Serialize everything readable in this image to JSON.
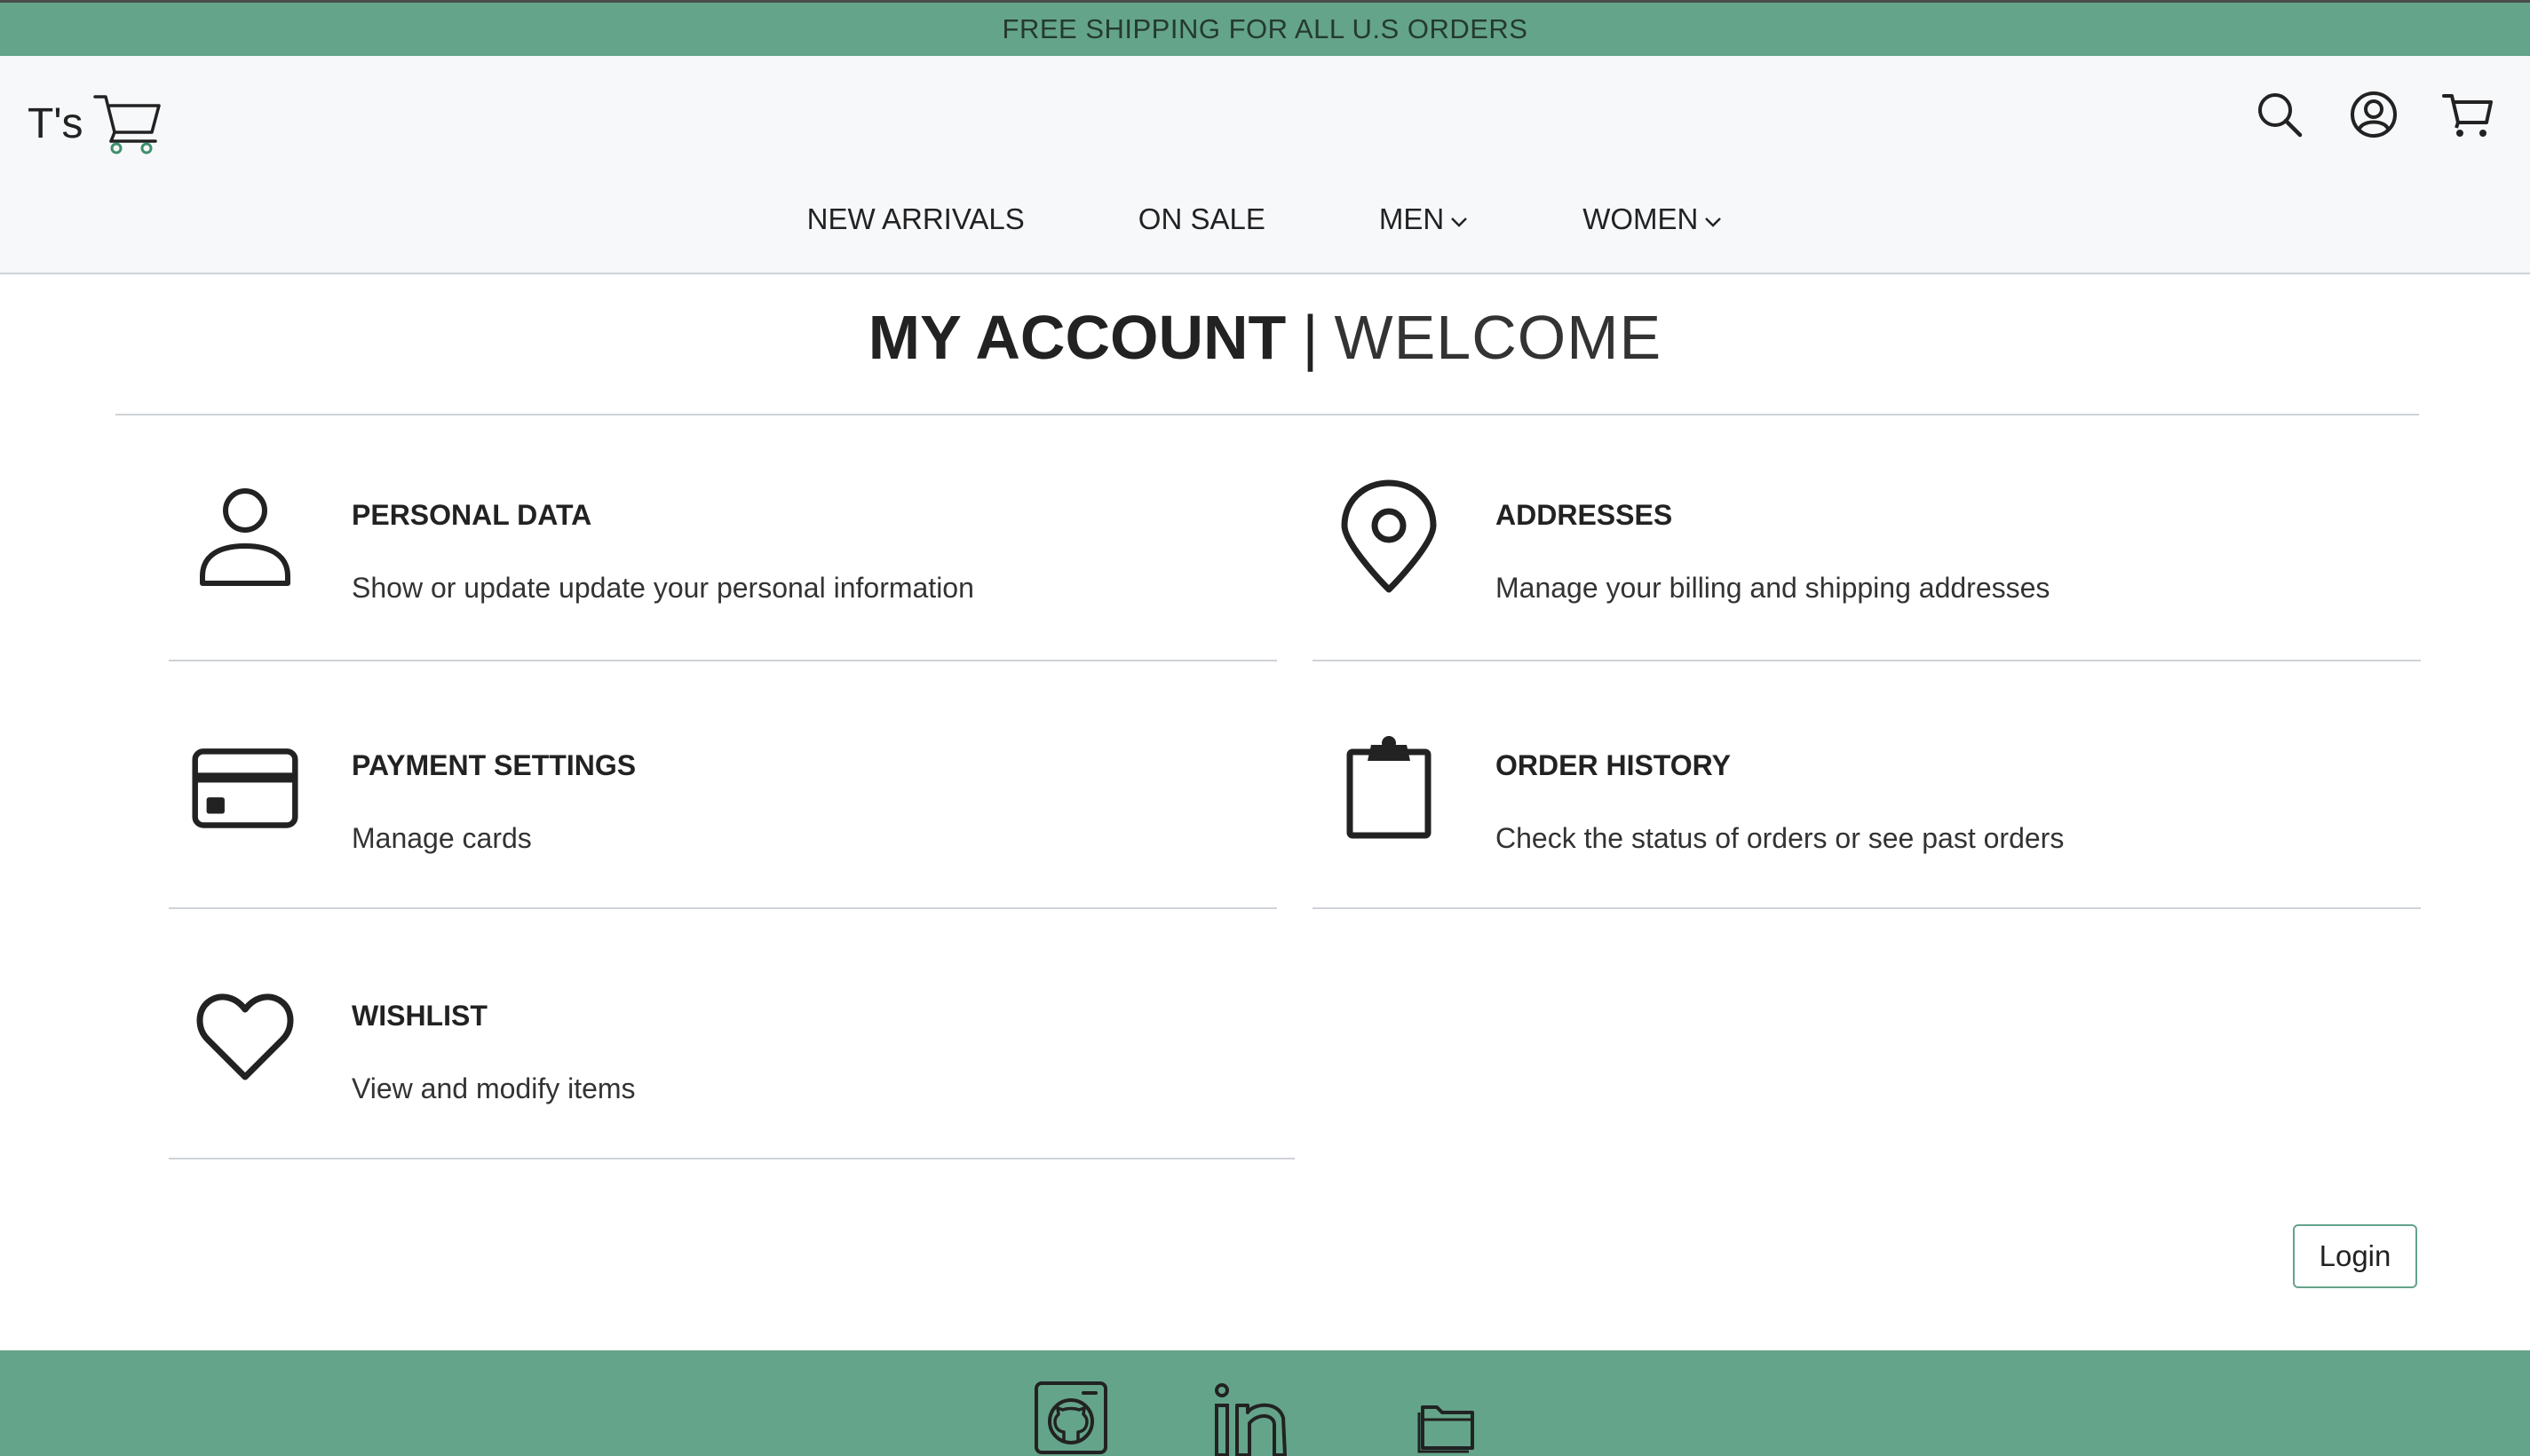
{
  "promo": {
    "text": "FREE SHIPPING FOR ALL U.S ORDERS"
  },
  "brand": {
    "text": "T's",
    "icon": "cart-logo-icon"
  },
  "header_icons": [
    "search-icon",
    "account-icon",
    "cart-icon"
  ],
  "nav": {
    "items": [
      {
        "label": "NEW ARRIVALS",
        "dropdown": false
      },
      {
        "label": "ON SALE",
        "dropdown": false
      },
      {
        "label": "MEN",
        "dropdown": true
      },
      {
        "label": "WOMEN",
        "dropdown": true
      }
    ]
  },
  "page_title": {
    "bold": "MY ACCOUNT",
    "separator": "|",
    "light": "WELCOME"
  },
  "cards": [
    {
      "title": "PERSONAL DATA",
      "description": "Show or update update your personal information",
      "icon": "person-icon"
    },
    {
      "title": "ADDRESSES",
      "description": "Manage your billing and shipping addresses",
      "icon": "location-pin-icon"
    },
    {
      "title": "PAYMENT SETTINGS",
      "description": "Manage cards",
      "icon": "credit-card-icon"
    },
    {
      "title": "ORDER HISTORY",
      "description": "Check the status of orders or see past orders",
      "icon": "clipboard-icon"
    },
    {
      "title": "WISHLIST",
      "description": "View and modify items",
      "icon": "heart-icon"
    }
  ],
  "login_button": {
    "label": "Login"
  },
  "footer_icons": [
    "github-icon",
    "linkedin-icon",
    "folder-icon"
  ],
  "colors": {
    "accent": "#64a48a",
    "header_bg": "#f7f8fa",
    "text": "#222222",
    "rule": "#cfd2d6"
  }
}
